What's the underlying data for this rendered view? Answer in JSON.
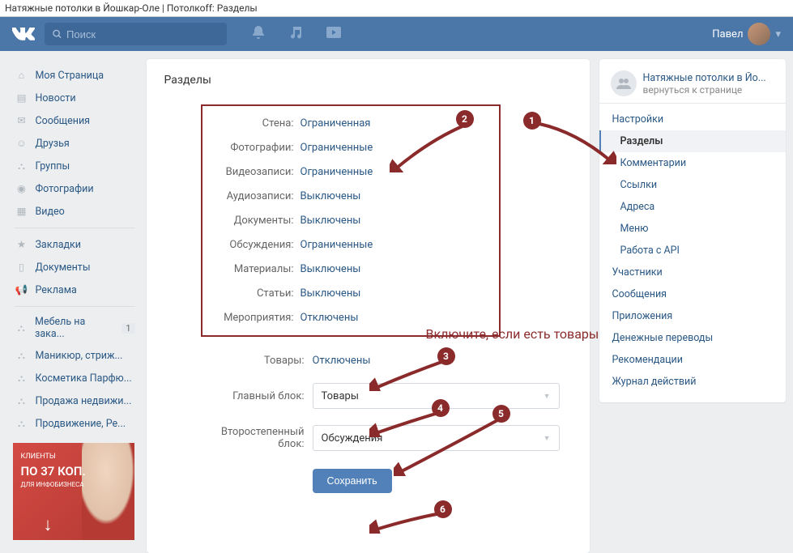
{
  "browser_title": "Натяжные потолки в Йошкар-Оле | Потолкоff: Разделы",
  "search_placeholder": "Поиск",
  "user_name": "Павел",
  "leftnav": {
    "my_page": "Моя Страница",
    "news": "Новости",
    "messages": "Сообщения",
    "friends": "Друзья",
    "groups": "Группы",
    "photos": "Фотографии",
    "videos": "Видео",
    "bookmarks": "Закладки",
    "docs": "Документы",
    "ads": "Реклама",
    "g1": "Мебель на зака...",
    "g1_badge": "1",
    "g2": "Маникюр, стриж...",
    "g3": "Косметика Парфю...",
    "g4": "Продажа недвижи...",
    "g5": "Продвижение, Ре..."
  },
  "promo": {
    "line1": "КЛИЕНТЫ",
    "line2": "ПО 37 КОП.",
    "line3": "ДЛЯ ИНФОБИЗНЕСА"
  },
  "page_title": "Разделы",
  "settings": {
    "wall": {
      "label": "Стена:",
      "value": "Ограниченная"
    },
    "photos": {
      "label": "Фотографии:",
      "value": "Ограниченные"
    },
    "videos": {
      "label": "Видеозаписи:",
      "value": "Ограниченные"
    },
    "audio": {
      "label": "Аудиозаписи:",
      "value": "Выключены"
    },
    "documents": {
      "label": "Документы:",
      "value": "Выключены"
    },
    "discussions": {
      "label": "Обсуждения:",
      "value": "Ограниченные"
    },
    "materials": {
      "label": "Материалы:",
      "value": "Выключены"
    },
    "articles": {
      "label": "Статьи:",
      "value": "Выключены"
    },
    "events": {
      "label": "Мероприятия:",
      "value": "Отключены"
    }
  },
  "goods": {
    "label": "Товары:",
    "value": "Отключены"
  },
  "main_block": {
    "label": "Главный блок:",
    "value": "Товары"
  },
  "secondary_block": {
    "label": "Второстепенный блок:",
    "value": "Обсуждения"
  },
  "save": "Сохранить",
  "group": {
    "name": "Натяжные потолки в Йо...",
    "back": "вернуться к странице"
  },
  "rmenu": {
    "settings": "Настройки",
    "sections": "Разделы",
    "comments": "Комментарии",
    "links": "Ссылки",
    "addresses": "Адреса",
    "menu": "Меню",
    "api": "Работа с API",
    "members": "Участники",
    "msgs": "Сообщения",
    "apps": "Приложения",
    "money": "Денежные переводы",
    "recs": "Рекомендации",
    "log": "Журнал действий"
  },
  "annotations": {
    "n1": "1",
    "n2": "2",
    "n3": "3",
    "n4": "4",
    "n5": "5",
    "n6": "6",
    "hint": "Включите, если есть товары"
  }
}
